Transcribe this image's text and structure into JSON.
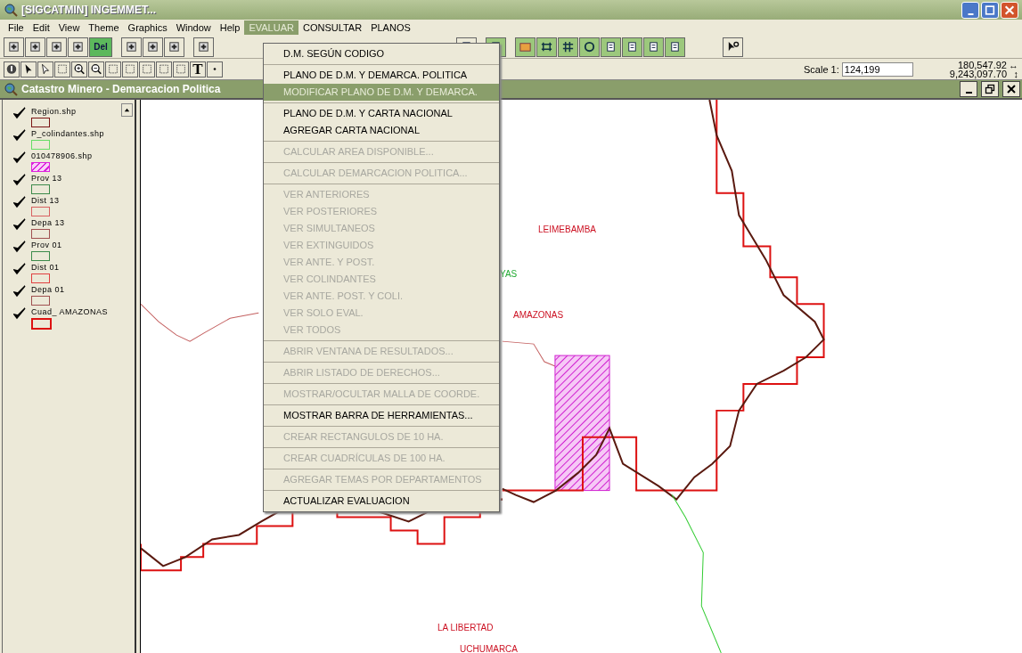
{
  "window": {
    "title": "[SIGCATMIN] INGEMMET..."
  },
  "menu_bar": [
    {
      "label": "File",
      "selected": false
    },
    {
      "label": "Edit",
      "selected": false
    },
    {
      "label": "View",
      "selected": false
    },
    {
      "label": "Theme",
      "selected": false
    },
    {
      "label": "Graphics",
      "selected": false
    },
    {
      "label": "Window",
      "selected": false
    },
    {
      "label": "Help",
      "selected": false
    },
    {
      "label": "EVALUAR",
      "selected": true
    },
    {
      "label": "CONSULTAR",
      "selected": false
    },
    {
      "label": "PLANOS",
      "selected": false
    }
  ],
  "toolbar": {
    "delete_label": "Del",
    "text_tool": "T",
    "scale_label": "Scale 1:",
    "scale_value": "124,199",
    "x_coord": "180,547.92",
    "x_arrow": "↔",
    "y_coord": "9,243,097.70",
    "y_arrow": "↕"
  },
  "document_window": {
    "title": "Catastro Minero - Demarcacion Politica"
  },
  "legend": [
    {
      "name": "Region.shp",
      "checked": true,
      "color": "#7a1414",
      "kind": "plain"
    },
    {
      "name": "P_colindantes.shp",
      "checked": true,
      "color": "#66dd66",
      "kind": "plain"
    },
    {
      "name": "010478906.shp",
      "checked": true,
      "color": "#dd22dd",
      "kind": "hatched"
    },
    {
      "name": "Prov 13",
      "checked": true,
      "color": "#3c8a4a",
      "kind": "plain"
    },
    {
      "name": "Dist 13",
      "checked": true,
      "color": "#d86060",
      "kind": "plain"
    },
    {
      "name": "Depa 13",
      "checked": true,
      "color": "#a05050",
      "kind": "plain"
    },
    {
      "name": "Prov 01",
      "checked": true,
      "color": "#3c8a4a",
      "kind": "plain"
    },
    {
      "name": "Dist 01",
      "checked": true,
      "color": "#e04040",
      "kind": "plain"
    },
    {
      "name": "Depa 01",
      "checked": true,
      "color": "#a05050",
      "kind": "plain"
    },
    {
      "name": "Cuad_ AMAZONAS",
      "checked": true,
      "color": "#dd1111",
      "kind": "bold"
    }
  ],
  "dropdown_menu": [
    [
      {
        "label": "D.M. SEGÚN CODIGO",
        "selected": false,
        "disabled": false
      }
    ],
    [
      {
        "label": "PLANO DE D.M. Y DEMARCA. POLITICA",
        "selected": false,
        "disabled": false
      },
      {
        "label": "MODIFICAR PLANO DE D.M. Y DEMARCA.",
        "selected": true,
        "disabled": false
      }
    ],
    [
      {
        "label": "PLANO DE D.M. Y CARTA NACIONAL",
        "selected": false,
        "disabled": false
      },
      {
        "label": "AGREGAR CARTA NACIONAL",
        "selected": false,
        "disabled": false
      }
    ],
    [
      {
        "label": "CALCULAR AREA DISPONIBLE...",
        "selected": false,
        "disabled": true
      }
    ],
    [
      {
        "label": "CALCULAR DEMARCACION POLITICA...",
        "selected": false,
        "disabled": true
      }
    ],
    [
      {
        "label": "VER ANTERIORES",
        "selected": false,
        "disabled": true
      },
      {
        "label": "VER POSTERIORES",
        "selected": false,
        "disabled": true
      },
      {
        "label": "VER SIMULTANEOS",
        "selected": false,
        "disabled": true
      },
      {
        "label": "VER EXTINGUIDOS",
        "selected": false,
        "disabled": true
      },
      {
        "label": "VER ANTE. Y POST.",
        "selected": false,
        "disabled": true
      },
      {
        "label": "VER COLINDANTES",
        "selected": false,
        "disabled": true
      },
      {
        "label": "VER ANTE. POST. Y COLI.",
        "selected": false,
        "disabled": true
      },
      {
        "label": "VER SOLO EVAL.",
        "selected": false,
        "disabled": true
      },
      {
        "label": "VER TODOS",
        "selected": false,
        "disabled": true
      }
    ],
    [
      {
        "label": "ABRIR VENTANA DE RESULTADOS...",
        "selected": false,
        "disabled": true
      }
    ],
    [
      {
        "label": "ABRIR LISTADO DE DERECHOS...",
        "selected": false,
        "disabled": true
      }
    ],
    [
      {
        "label": "MOSTRAR/OCULTAR MALLA DE COORDE.",
        "selected": false,
        "disabled": true
      }
    ],
    [
      {
        "label": "MOSTRAR BARRA DE HERRAMIENTAS...",
        "selected": false,
        "disabled": false
      }
    ],
    [
      {
        "label": "CREAR RECTANGULOS DE 10 HA.",
        "selected": false,
        "disabled": true
      }
    ],
    [
      {
        "label": "CREAR CUADRÍCULAS DE 100 HA.",
        "selected": false,
        "disabled": true
      }
    ],
    [
      {
        "label": "AGREGAR TEMAS POR DEPARTAMENTOS",
        "selected": false,
        "disabled": true
      }
    ],
    [
      {
        "label": "ACTUALIZAR EVALUACION",
        "selected": false,
        "disabled": false
      }
    ]
  ],
  "map_labels": [
    {
      "text": "LEIMEBAMBA",
      "color": "#cc1122"
    },
    {
      "text": "YAS",
      "color": "#22aa33"
    },
    {
      "text": "AMAZONAS",
      "color": "#cc1122"
    },
    {
      "text": "LA LIBERTAD",
      "color": "#cc1122"
    },
    {
      "text": "UCHUMARCA",
      "color": "#cc1122"
    }
  ]
}
